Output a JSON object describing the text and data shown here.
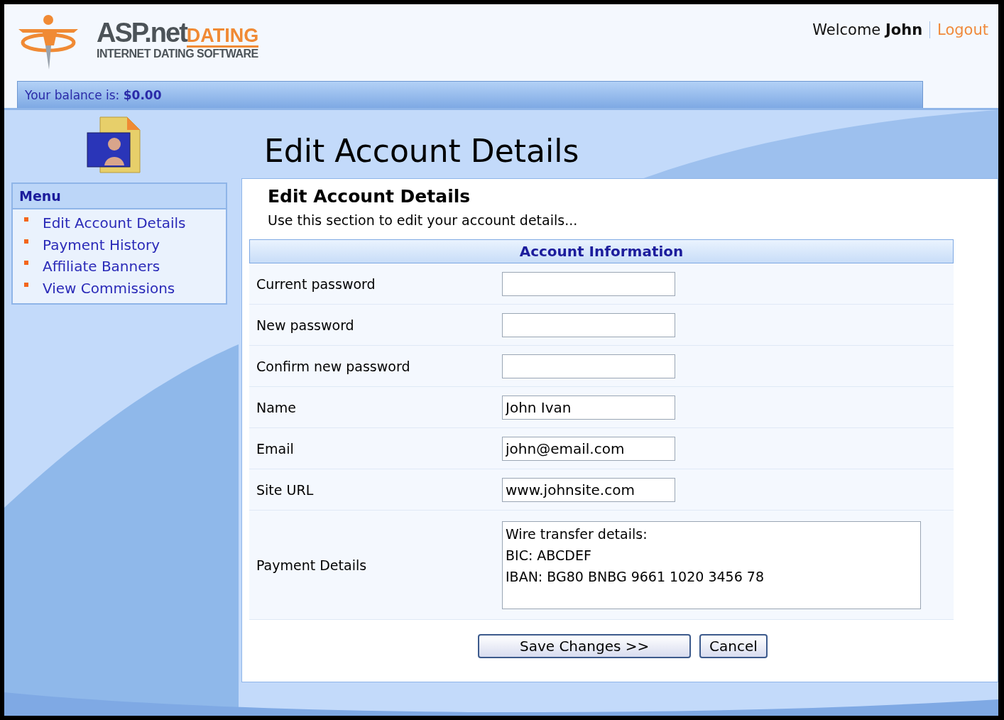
{
  "logo": {
    "brand": "ASP.net",
    "accent": "DATING",
    "tagline": "INTERNET DATING SOFTWARE"
  },
  "user": {
    "greeting": "Welcome",
    "name": "John",
    "logout": "Logout"
  },
  "balance": {
    "label": "Your balance is:",
    "amount": "$0.00"
  },
  "page_title": "Edit Account Details",
  "menu": {
    "title": "Menu",
    "items": [
      {
        "label": "Edit Account Details"
      },
      {
        "label": "Payment History"
      },
      {
        "label": "Affiliate Banners"
      },
      {
        "label": "View Commissions"
      }
    ]
  },
  "section": {
    "title": "Edit Account Details",
    "description": "Use this section to edit your account details..."
  },
  "form": {
    "title": "Account Information",
    "fields": [
      {
        "label": "Current password",
        "kind": "password"
      },
      {
        "label": "New password",
        "kind": "password"
      },
      {
        "label": "Confirm new password",
        "kind": "password"
      },
      {
        "label": "Name",
        "kind": "text",
        "value": "John Ivan"
      },
      {
        "label": "Email",
        "kind": "text",
        "value": "john@email.com"
      },
      {
        "label": "Site URL",
        "kind": "text",
        "value": "www.johnsite.com"
      },
      {
        "label": "Payment Details",
        "kind": "textarea",
        "value": "Wire transfer details:\nBIC: ABCDEF\nIBAN: BG80 BNBG 9661 1020 3456 78"
      }
    ]
  },
  "buttons": [
    {
      "label": "Save Changes >>",
      "kind": "primary"
    },
    {
      "label": "Cancel",
      "kind": "secondary"
    }
  ]
}
